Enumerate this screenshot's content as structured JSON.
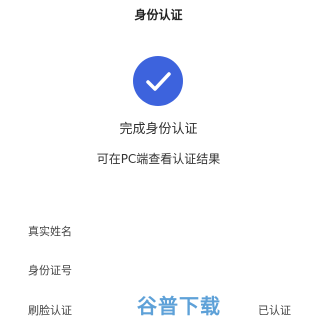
{
  "header": {
    "title": "身份认证"
  },
  "result": {
    "icon": "check-circle-icon",
    "accent_color": "#3d63dd",
    "title": "完成身份认证",
    "subtitle": "可在PC端查看认证结果"
  },
  "rows": [
    {
      "label": "真实姓名",
      "value": ""
    },
    {
      "label": "身份证号",
      "value": ""
    },
    {
      "label": "刷脸认证",
      "value": "已认证"
    }
  ],
  "watermark": {
    "text": "谷普下载",
    "color": "#5ea1d8"
  }
}
